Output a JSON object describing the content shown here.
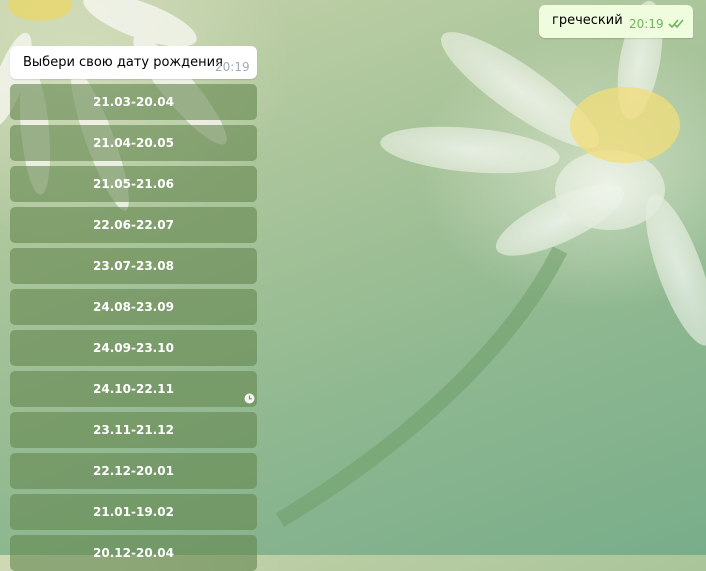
{
  "messages": {
    "outgoing": {
      "text": "греческий",
      "time": "20:19",
      "status_icon": "double-check-icon"
    },
    "incoming": {
      "text": "Выбери свою дату рождения",
      "time": "20:19"
    }
  },
  "keyboard": {
    "buttons": [
      "21.03-20.04",
      "21.04-20.05",
      "21.05-21.06",
      "22.06-22.07",
      "23.07-23.08",
      "24.08-23.09",
      "24.09-23.10",
      "24.10-22.11",
      "23.11-21.12",
      "22.12-20.01",
      "21.01-19.02",
      "20.12-20.04"
    ]
  },
  "icons": {
    "pending": "clock-icon"
  },
  "colors": {
    "outgoing_bubble": "#effdde",
    "incoming_bubble": "#ffffff",
    "keyboard_button": "#668750",
    "read_check": "#6fb45a"
  }
}
